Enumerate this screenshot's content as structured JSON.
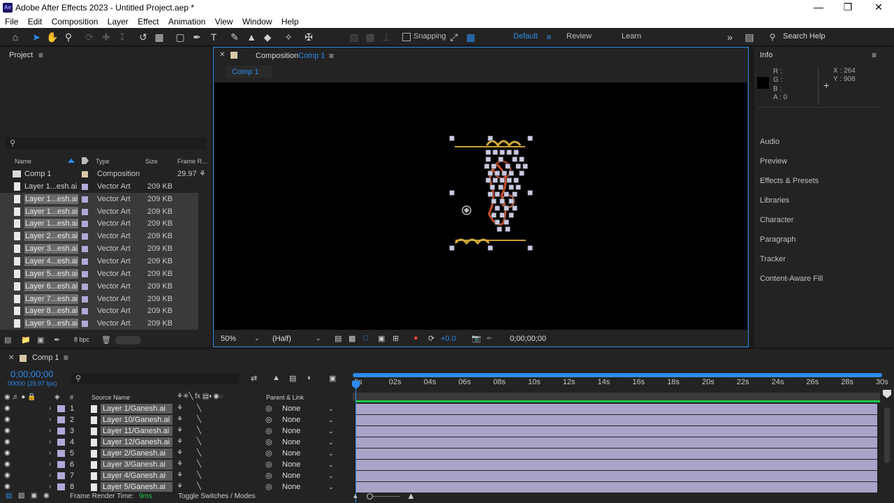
{
  "window": {
    "title": "Adobe After Effects 2023 - Untitled Project.aep *",
    "logo": "Ae"
  },
  "menu": [
    "File",
    "Edit",
    "Composition",
    "Layer",
    "Effect",
    "Animation",
    "View",
    "Window",
    "Help"
  ],
  "toolbar": {
    "snapping": "Snapping",
    "workspaces": {
      "default": "Default",
      "review": "Review",
      "learn": "Learn"
    },
    "search_help": "Search Help"
  },
  "project": {
    "title": "Project",
    "columns": {
      "name": "Name",
      "type": "Type",
      "size": "Size",
      "frame_rate": "Frame R..."
    },
    "rows": [
      {
        "name": "Comp 1",
        "type": "Composition",
        "size": "",
        "fps": "29.97",
        "selected": false
      },
      {
        "name": "Layer 1...esh.ai",
        "type": "Vector Art",
        "size": "209 KB",
        "fps": "",
        "selected": false
      },
      {
        "name": "Layer 1...esh.ai",
        "type": "Vector Art",
        "size": "209 KB",
        "fps": "",
        "selected": true
      },
      {
        "name": "Layer 1...esh.ai",
        "type": "Vector Art",
        "size": "209 KB",
        "fps": "",
        "selected": true
      },
      {
        "name": "Layer 1...esh.ai",
        "type": "Vector Art",
        "size": "209 KB",
        "fps": "",
        "selected": true
      },
      {
        "name": "Layer 2...esh.ai",
        "type": "Vector Art",
        "size": "209 KB",
        "fps": "",
        "selected": true
      },
      {
        "name": "Layer 3...esh.ai",
        "type": "Vector Art",
        "size": "209 KB",
        "fps": "",
        "selected": true
      },
      {
        "name": "Layer 4...esh.ai",
        "type": "Vector Art",
        "size": "209 KB",
        "fps": "",
        "selected": true
      },
      {
        "name": "Layer 5...esh.ai",
        "type": "Vector Art",
        "size": "209 KB",
        "fps": "",
        "selected": true
      },
      {
        "name": "Layer 6...esh.ai",
        "type": "Vector Art",
        "size": "209 KB",
        "fps": "",
        "selected": true
      },
      {
        "name": "Layer 7...esh.ai",
        "type": "Vector Art",
        "size": "209 KB",
        "fps": "",
        "selected": true
      },
      {
        "name": "Layer 8...esh.ai",
        "type": "Vector Art",
        "size": "209 KB",
        "fps": "",
        "selected": true
      },
      {
        "name": "Layer 9...esh.ai",
        "type": "Vector Art",
        "size": "209 KB",
        "fps": "",
        "selected": true
      }
    ],
    "bpc": "8 bpc"
  },
  "composition": {
    "panel_title": "Composition",
    "comp_name": "Comp 1",
    "tab": "Comp 1",
    "zoom": "50%",
    "resolution": "(Half)",
    "exposure": "+0.0",
    "timecode": "0;00;00;00"
  },
  "info": {
    "title": "Info",
    "r": "R :",
    "g": "G :",
    "b": "B :",
    "a": "A : 0",
    "x": "X : 264",
    "y": "Y : 908"
  },
  "right_panels": [
    "Audio",
    "Preview",
    "Effects & Presets",
    "Libraries",
    "Character",
    "Paragraph",
    "Tracker",
    "Content-Aware Fill"
  ],
  "timeline": {
    "tab": "Comp 1",
    "timecode": "0;00;00;00",
    "fps_line": "00000 (29.97 fps)",
    "col_source": "Source Name",
    "col_parent": "Parent & Link",
    "ruler": [
      "0s",
      "02s",
      "04s",
      "06s",
      "08s",
      "10s",
      "12s",
      "14s",
      "16s",
      "18s",
      "20s",
      "22s",
      "24s",
      "26s",
      "28s",
      "30s"
    ],
    "layers": [
      {
        "num": "1",
        "name": "Layer 1/Ganesh.ai",
        "parent": "None"
      },
      {
        "num": "2",
        "name": "Layer 10/Ganesh.ai",
        "parent": "None"
      },
      {
        "num": "3",
        "name": "Layer 11/Ganesh.ai",
        "parent": "None"
      },
      {
        "num": "4",
        "name": "Layer 12/Ganesh.ai",
        "parent": "None"
      },
      {
        "num": "5",
        "name": "Layer 2/Ganesh.ai",
        "parent": "None"
      },
      {
        "num": "6",
        "name": "Layer 3/Ganesh.ai",
        "parent": "None"
      },
      {
        "num": "7",
        "name": "Layer 4/Ganesh.ai",
        "parent": "None"
      },
      {
        "num": "8",
        "name": "Layer 5/Ganesh.ai",
        "parent": "None"
      }
    ],
    "frame_render_label": "Frame Render Time:",
    "frame_render_value": "9ms",
    "toggle_label": "Toggle Switches / Modes"
  },
  "colors": {
    "accent": "#2d8ceb",
    "label_lavender": "#b2a8d8",
    "layer_bar": "#a9a3c8",
    "work_area": "#23c54b",
    "gold": "#c8a030",
    "ornament_red": "#c8502a"
  }
}
